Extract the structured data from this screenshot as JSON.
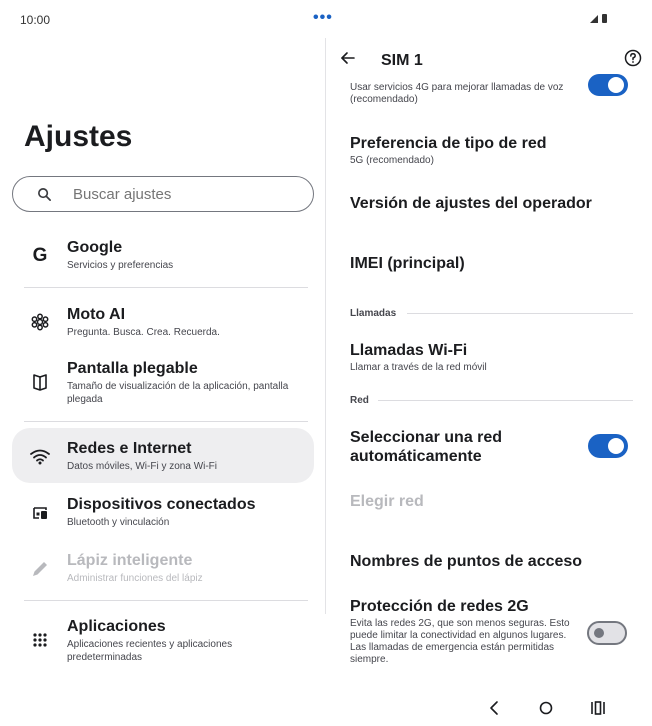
{
  "status": {
    "time": "10:00",
    "dots": "•••"
  },
  "settings": {
    "title": "Ajustes",
    "search": {
      "placeholder": "Buscar ajustes"
    },
    "items": [
      {
        "icon": "google-icon",
        "title": "Google",
        "subtitle": "Servicios y preferencias"
      },
      {
        "icon": "moto-ai-icon",
        "title": "Moto AI",
        "subtitle": "Pregunta. Busca. Crea. Recuerda."
      },
      {
        "icon": "foldable-screen-icon",
        "title": "Pantalla plegable",
        "subtitle": "Tamaño de visualización de la aplicación, pantalla plegada"
      },
      {
        "icon": "wifi-icon",
        "title": "Redes e Internet",
        "subtitle": "Datos móviles, Wi-Fi y zona Wi-Fi",
        "selected": true
      },
      {
        "icon": "connected-devices-icon",
        "title": "Dispositivos conectados",
        "subtitle": "Bluetooth y vinculación"
      },
      {
        "icon": "pen-icon",
        "title": "Lápiz inteligente",
        "subtitle": "Administrar funciones del lápiz",
        "disabled": true
      },
      {
        "icon": "apps-grid-icon",
        "title": "Aplicaciones",
        "subtitle": "Aplicaciones recientes y aplicaciones predeterminadas"
      }
    ]
  },
  "sim": {
    "title": "SIM 1",
    "top_partial_text": "Usar servicios 4G para mejorar llamadas de voz (recomendado)",
    "top_toggle_on": true,
    "network_type": {
      "title": "Preferencia de tipo de red",
      "subtitle": "5G (recomendado)"
    },
    "carrier_version": {
      "title": "Versión de ajustes del operador"
    },
    "imei": {
      "title": "IMEI (principal)"
    },
    "section_calls": "Llamadas",
    "wifi_calls": {
      "title": "Llamadas Wi-Fi",
      "subtitle": "Llamar a través de la red móvil"
    },
    "section_network": "Red",
    "auto_network": {
      "title": "Seleccionar una red automáticamente",
      "toggle_on": true
    },
    "choose_network": {
      "title": "Elegir red",
      "disabled": true
    },
    "apn": {
      "title": "Nombres de puntos de acceso"
    },
    "protection_2g": {
      "title": "Protección de redes 2G",
      "subtitle": "Evita las redes 2G, que son menos seguras. Esto puede limitar la conectividad en algunos lugares. Las llamadas de emergencia están permitidas siempre.",
      "toggle_on": false
    }
  },
  "colors": {
    "accent": "#1a62c4",
    "selected_bg": "#eeeef0",
    "text": "#1b1c1f",
    "subtext": "#45464d",
    "disabled": "#b8b9bd"
  }
}
